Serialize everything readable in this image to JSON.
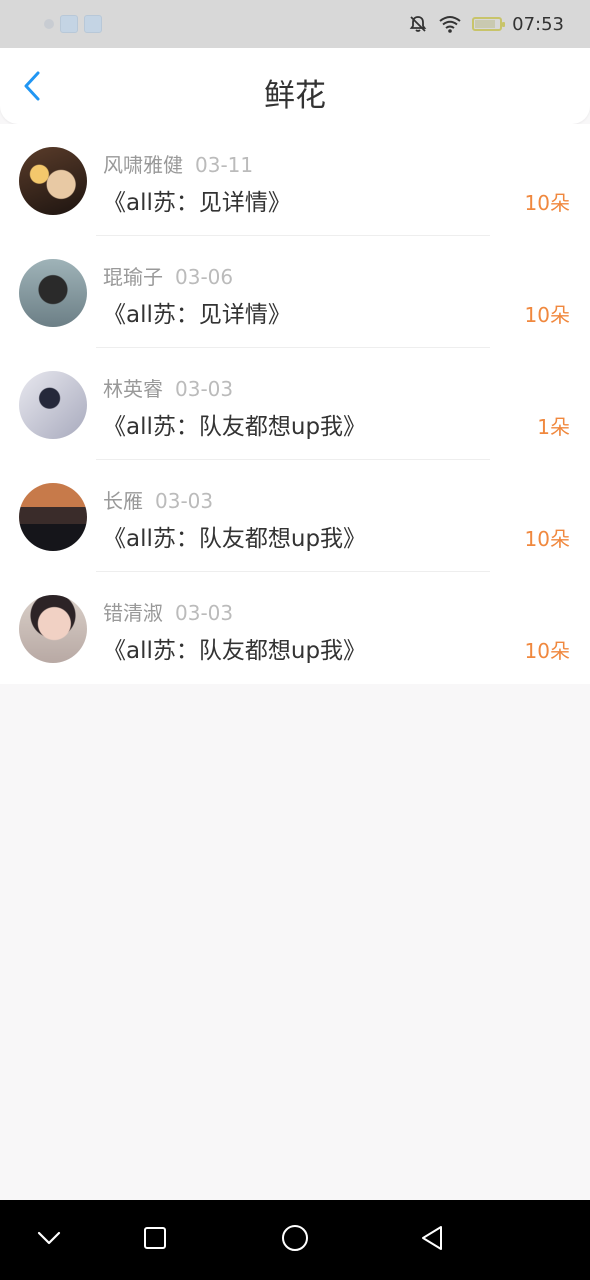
{
  "status_bar": {
    "time": "07:53",
    "icons": [
      "bell-off-icon",
      "wifi-icon",
      "battery-icon"
    ]
  },
  "header": {
    "title": "鲜花",
    "back_icon": "chevron-left-icon",
    "accent": "#2196F3"
  },
  "colors": {
    "count": "#f0883e",
    "title_text": "#333333",
    "meta_text": "#999999"
  },
  "items": [
    {
      "name": "风啸雅健",
      "date": "03-11",
      "title": "《all苏：见详情》",
      "count": "10朵"
    },
    {
      "name": "琨瑜子",
      "date": "03-06",
      "title": "《all苏：见详情》",
      "count": "10朵"
    },
    {
      "name": "林英睿",
      "date": "03-03",
      "title": "《all苏：队友都想up我》",
      "count": "1朵"
    },
    {
      "name": "长雁",
      "date": "03-03",
      "title": "《all苏：队友都想up我》",
      "count": "10朵"
    },
    {
      "name": "错清淑",
      "date": "03-03",
      "title": "《all苏：队友都想up我》",
      "count": "10朵"
    }
  ],
  "nav_bar": {
    "icons": [
      "chevron-down-icon",
      "square-icon",
      "circle-icon",
      "triangle-back-icon"
    ]
  }
}
